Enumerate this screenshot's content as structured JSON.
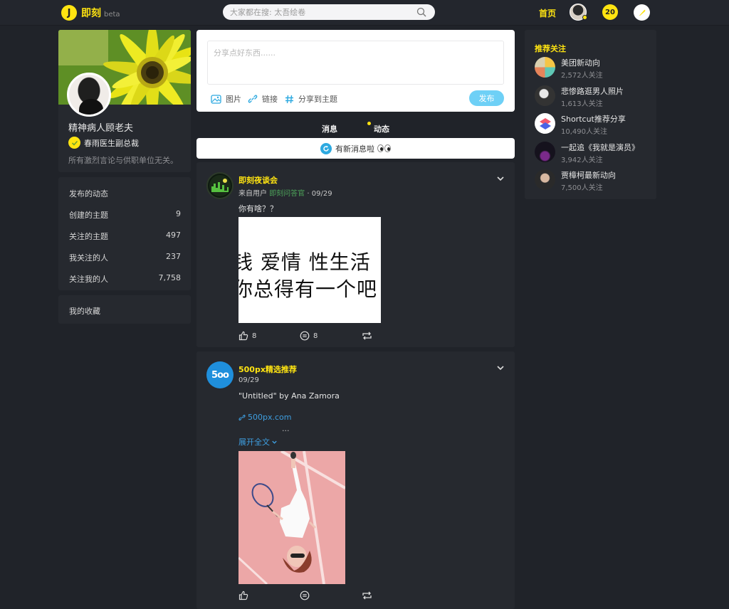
{
  "header": {
    "logo_char": "J",
    "app_name": "即刻",
    "beta": "beta",
    "search_placeholder": "大家都在搜: 太吾绘卷",
    "nav_home": "首页",
    "notification_count": "20"
  },
  "profile": {
    "name": "精神病人顾老夫",
    "badge": "春雨医生副总裁",
    "bio": "所有激烈言论与供职单位无关。"
  },
  "stats": [
    {
      "label": "发布的动态",
      "value": ""
    },
    {
      "label": "创建的主题",
      "value": "9"
    },
    {
      "label": "关注的主题",
      "value": "497"
    },
    {
      "label": "我关注的人",
      "value": "237"
    },
    {
      "label": "关注我的人",
      "value": "7,758"
    }
  ],
  "favorites_label": "我的收藏",
  "composer": {
    "placeholder": "分享点好东西......",
    "image_label": "图片",
    "link_label": "链接",
    "topic_label": "分享到主题",
    "publish_label": "发布"
  },
  "tabs": {
    "messages": "消息",
    "activity": "动态"
  },
  "new_messages": "有新消息啦",
  "posts": [
    {
      "author": "即刻夜谈会",
      "from_prefix": "来自用户",
      "from_source": "即刻问答官",
      "date": "· 09/29",
      "text": "你有啥？？",
      "image_lines": [
        "钱 爱情 性生活",
        "你总得有一个吧"
      ],
      "likes": "8",
      "comments": "8"
    },
    {
      "author": "500px精选推荐",
      "date": "09/29",
      "text": "\"Untitled\" by Ana Zamora",
      "link": "500px.com",
      "ellipsis": "...",
      "expand": "展开全文",
      "avatar_text": "5oo"
    }
  ],
  "recommend": {
    "title": "推荐关注",
    "items": [
      {
        "name": "美团新动向",
        "followers": "2,572人关注"
      },
      {
        "name": "悲惨路逛男人照片",
        "followers": "1,613人关注"
      },
      {
        "name": "Shortcut推荐分享",
        "followers": "10,490人关注"
      },
      {
        "name": "一起追《我就是演员》",
        "followers": "3,942人关注"
      },
      {
        "name": "贾樟柯最新动向",
        "followers": "7,500人关注"
      }
    ]
  },
  "colors": {
    "accent": "#ffe411",
    "background": "#202329",
    "card": "#26292f",
    "link": "#3e9ee0",
    "publish": "#6ed0f6"
  }
}
